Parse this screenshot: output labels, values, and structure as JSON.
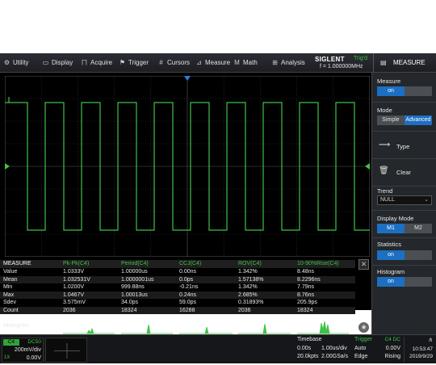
{
  "menu": {
    "utility": "Utility",
    "display": "Display",
    "acquire": "Acquire",
    "trigger": "Trigger",
    "cursors": "Cursors",
    "measure": "Measure",
    "math": "Math",
    "analysis": "Analysis"
  },
  "brand": {
    "logo": "SIGLENT",
    "trig_status": "Trig'd",
    "frequency": "f = 1.000000MHz"
  },
  "header_title": "MEASURE",
  "measure_table": {
    "title": "MEASURE",
    "columns": [
      "Pk-Pk(C4)",
      "Period(C4)",
      "CCJ(C4)",
      "ROV(C4)",
      "10-90%Rise(C4)"
    ],
    "rows": [
      {
        "label": "Value",
        "cells": [
          "1.0333V",
          "1.00000us",
          "0.00ns",
          "1.342%",
          "8.48ns"
        ]
      },
      {
        "label": "Mean",
        "cells": [
          "1.032531V",
          "1.0000001us",
          "0.0ps",
          "1.57138%",
          "8.2296ns"
        ]
      },
      {
        "label": "Min",
        "cells": [
          "1.0200V",
          "999.88ns",
          "-0.21ns",
          "1.342%",
          "7.79ns"
        ]
      },
      {
        "label": "Max",
        "cells": [
          "1.0467V",
          "1.00013us",
          "0.24ns",
          "2.685%",
          "8.76ns"
        ]
      },
      {
        "label": "Sdev",
        "cells": [
          "3.575mV",
          "34.0ps",
          "59.0ps",
          "0.31893%",
          "205.9ps"
        ]
      },
      {
        "label": "Count",
        "cells": [
          "2036",
          "18324",
          "16288",
          "2036",
          "18324"
        ]
      }
    ],
    "histogram_label": "Histogram",
    "close_icon": "close-icon"
  },
  "panel": {
    "measure_label": "Measure",
    "measure_on": "on",
    "mode_label": "Mode",
    "mode_simple": "Simple",
    "mode_advanced": "Advanced",
    "type_label": "Type",
    "clear_label": "Clear",
    "trend_label": "Trend",
    "trend_value": "NULL",
    "display_mode_label": "Display Mode",
    "display_m1": "M1",
    "display_m2": "M2",
    "statistics_label": "Statistics",
    "statistics_on": "on",
    "histogram_label": "Histogram",
    "histogram_on": "on"
  },
  "channel": {
    "tag": "C4",
    "coupling": "DC50",
    "scale": "200mV/div",
    "bw": "1X",
    "offset": "0.00V"
  },
  "timebase": {
    "title": "Timebase",
    "delay": "0.00s",
    "scale": "1.00us/div",
    "points": "20.0kpts",
    "rate": "2.00GSa/s"
  },
  "trigger": {
    "title": "Trigger",
    "source": "C4 DC",
    "mode": "Auto",
    "level": "0.00V",
    "type": "Edge",
    "slope": "Rising"
  },
  "clock": {
    "time": "10:53:47",
    "date": "2019/9/29"
  },
  "colors": {
    "trace": "#3ec24a",
    "accent": "#1c6fc2",
    "trigger_marker": "#2f7ee0"
  }
}
